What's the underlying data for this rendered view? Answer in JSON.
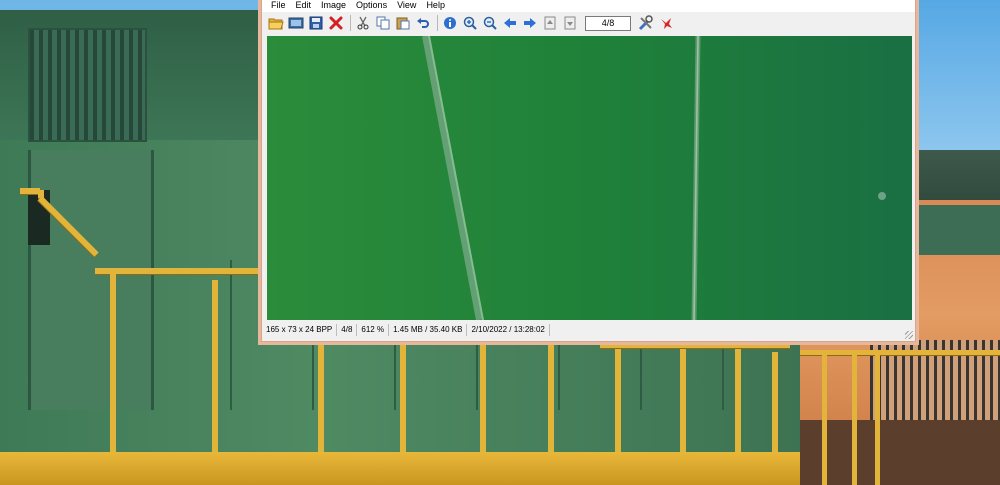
{
  "menu": {
    "items": [
      "File",
      "Edit",
      "Image",
      "Options",
      "View",
      "Help"
    ]
  },
  "toolbar": {
    "page_indicator": "4/8",
    "icons": [
      "open-folder-icon",
      "slideshow-icon",
      "save-icon",
      "delete-icon",
      "cut-icon",
      "copy-icon",
      "paste-icon",
      "undo-icon",
      "info-icon",
      "zoom-in-icon",
      "zoom-out-icon",
      "previous-icon",
      "next-icon",
      "first-page-icon",
      "last-page-icon",
      "settings-icon",
      "exit-icon"
    ]
  },
  "status": {
    "dimensions": "165 x 73 x 24 BPP",
    "page": "4/8",
    "zoom": "612 %",
    "size": "1.45 MB / 35.40 KB",
    "datetime": "2/10/2022 / 13:28:02"
  },
  "colors": {
    "window_border": "#e7b79c",
    "canvas_green": "#238536",
    "rail_yellow": "#e3b43a",
    "loco_orange": "#e39c63"
  }
}
